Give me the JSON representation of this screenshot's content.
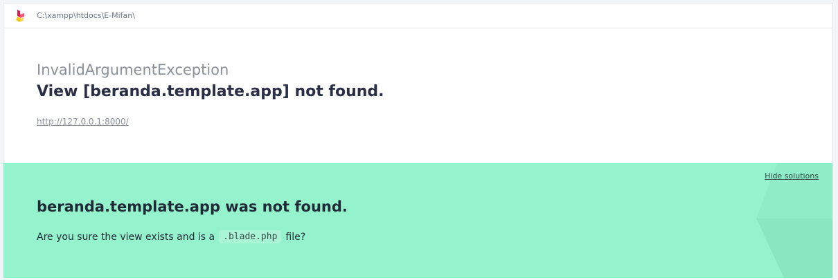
{
  "topbar": {
    "path": "C:\\xampp\\htdocs\\E-Mifan\\",
    "logo_icon": "ignition-flame-logo"
  },
  "exception": {
    "class": "InvalidArgumentException",
    "message": "View [beranda.template.app] not found.",
    "url": "http://127.0.0.1:8000/"
  },
  "solution": {
    "hide_label": "Hide solutions",
    "title": "beranda.template.app was not found.",
    "desc_before": "Are you sure the view exists and is a",
    "code": ".blade.php",
    "desc_after": "file?",
    "background": "#94f2cc"
  }
}
